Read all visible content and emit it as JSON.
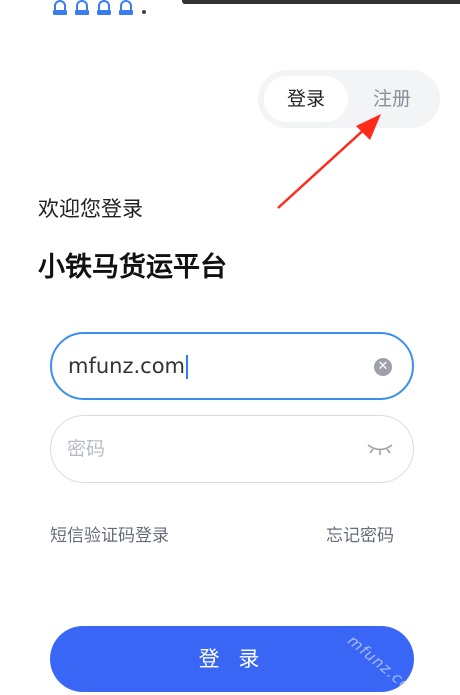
{
  "status_bar": {
    "icons": [
      "app-notification-icon",
      "app-notification-icon",
      "app-notification-icon",
      "app-notification-icon"
    ]
  },
  "auth_tabs": {
    "login_label": "登录",
    "register_label": "注册",
    "active": "登录"
  },
  "header": {
    "welcome": "欢迎您登录",
    "platform_name": "小铁马货运平台"
  },
  "form": {
    "username_value": "mfunz.com",
    "password_placeholder": "密码"
  },
  "links": {
    "sms_login": "短信验证码登录",
    "forgot_password": "忘记密码"
  },
  "login_button": "登 录",
  "watermark": "mfunz.co",
  "colors": {
    "primary": "#3a66f5",
    "focus_border": "#3b8ff0",
    "annotation_arrow": "#ff2a1a"
  }
}
